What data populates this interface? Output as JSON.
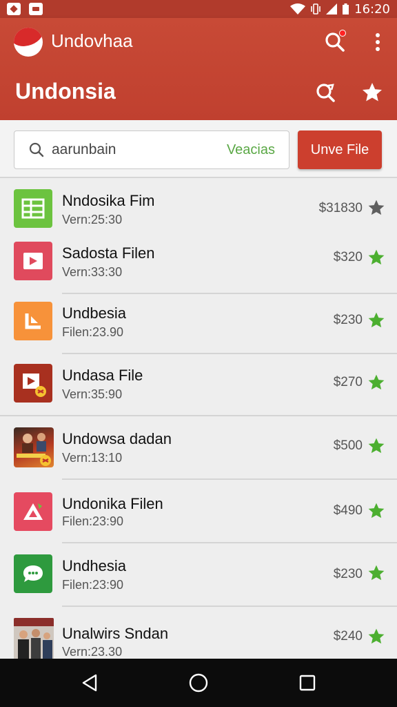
{
  "status_bar": {
    "time": "16:20",
    "icons": [
      "notification-icon",
      "lock-icon",
      "wifi-icon",
      "vibrate-icon",
      "signal-icon",
      "battery-icon"
    ]
  },
  "app_bar": {
    "app_name": "Undovhaa",
    "title": "Undonsia"
  },
  "search": {
    "value": "aarunbain",
    "category": "Veacias",
    "action_label": "Unve File"
  },
  "colors": {
    "primary": "#c84a36",
    "accent_green": "#4caf30",
    "star_grey": "#666666"
  },
  "items": [
    {
      "name": "Nndosika Fim",
      "sub": "Vern:25:30",
      "price": "$31830",
      "starred": false,
      "icon": "spreadsheet-icon"
    },
    {
      "name": "Sadosta Filen",
      "sub": "Vern:33:30",
      "price": "$320",
      "starred": true,
      "icon": "video-icon"
    },
    {
      "name": "Undbesia",
      "sub": "Filen:23.90",
      "price": "$230",
      "starred": true,
      "icon": "corner-icon"
    },
    {
      "name": "Undasa File",
      "sub": "Vern:35:90",
      "price": "$270",
      "starred": true,
      "icon": "play-icon"
    },
    {
      "name": "Undowsa dadan",
      "sub": "Vern:13:10",
      "price": "$500",
      "starred": true,
      "icon": "movie-poster-icon"
    },
    {
      "name": "Undonika Filen",
      "sub": "Filen:23:90",
      "price": "$490",
      "starred": true,
      "icon": "triangle-icon"
    },
    {
      "name": "Undhesia",
      "sub": "Filen:23:90",
      "price": "$230",
      "starred": true,
      "icon": "chat-icon"
    },
    {
      "name": "Unalwirs Sndan",
      "sub": "Vern:23.30",
      "price": "$240",
      "starred": true,
      "icon": "people-photo-icon"
    }
  ]
}
